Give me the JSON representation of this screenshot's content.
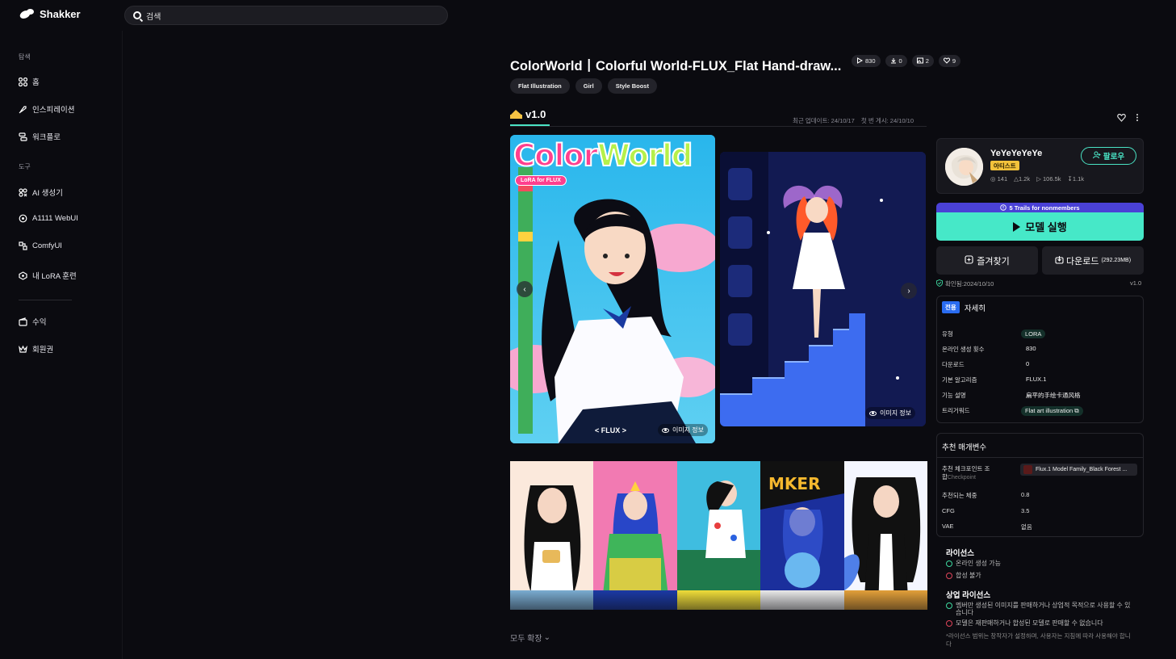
{
  "brand": {
    "name": "Shakker"
  },
  "search": {
    "text": "검색"
  },
  "sidebar": {
    "sections": [
      {
        "label": "탐색"
      },
      {
        "label": "도구"
      }
    ],
    "items": [
      {
        "label": "홈",
        "icon": "grid-icon"
      },
      {
        "label": "인스피레이션",
        "icon": "rocket-icon"
      },
      {
        "label": "워크플로",
        "icon": "workflow-icon"
      },
      {
        "label": "AI 생성기",
        "icon": "ai-generator-icon"
      },
      {
        "label": "A1111 WebUI",
        "icon": "webui-icon"
      },
      {
        "label": "ComfyUI",
        "icon": "comfyui-icon"
      },
      {
        "label": "내 LoRA 훈련",
        "icon": "lora-train-icon"
      },
      {
        "label": "수익",
        "icon": "wallet-icon"
      },
      {
        "label": "회원권",
        "icon": "crown-icon"
      }
    ]
  },
  "model": {
    "title": "ColorWorld丨Colorful World-FLUX_Flat Hand-draw...",
    "stats": {
      "runs": "830",
      "downloads": "0",
      "images": "2",
      "likes": "9"
    },
    "tags": [
      "Flat Illustration",
      "Girl",
      "Style Boost"
    ],
    "version": "v1.0",
    "updated": "최근 업데이트: 24/10/17",
    "published": "첫 번 게시: 24/10/10",
    "image_info_label": "이미지 정보",
    "main_image_title_part1": "Color",
    "main_image_title_part2": "World",
    "main_image_badge": "LoRA for FLUX",
    "main_image_footer": "< FLUX >",
    "expand_all": "모두 확장"
  },
  "author": {
    "name": "YeYeYeYeYe",
    "badge": "아티스트",
    "followers": "141",
    "likes": "1.2k",
    "runs": "106.5k",
    "downloads": "1.1k",
    "follow_label": "팔로우"
  },
  "actions": {
    "trial": "5 Trails for nonmembers",
    "run": "모델 실행",
    "favorite": "즐겨찾기",
    "download": "다운로드",
    "download_size": "(292.23MB)",
    "verified": "확인됨:2024/10/10",
    "verified_version": "v1.0"
  },
  "details": {
    "exclusive": "전용",
    "title": "자세히",
    "rows": [
      {
        "k": "유형",
        "v": "LORA"
      },
      {
        "k": "온라인 생성 횟수",
        "v": "830"
      },
      {
        "k": "다운로드",
        "v": "0"
      },
      {
        "k": "기본 알고리즘",
        "v": "FLUX.1"
      },
      {
        "k": "기능 설명",
        "v": "扁平的手绘卡通风格"
      },
      {
        "k": "트리거워드",
        "v": "Flat art illustration"
      }
    ]
  },
  "params": {
    "title": "추천 매개변수",
    "checkpoint_label_1": "추천 체크포인트 조",
    "checkpoint_label_2": "합",
    "checkpoint_sub": "Checkpoint",
    "checkpoint_value": "Flux.1 Model Family_Black Forest ...",
    "rows": [
      {
        "k": "추천되는 체중",
        "v": "0.8"
      },
      {
        "k": "CFG",
        "v": "3.5"
      },
      {
        "k": "VAE",
        "v": "없음"
      }
    ]
  },
  "license": {
    "title": "라이선스",
    "items": [
      {
        "text": "온라인 생성 가능",
        "ok": true
      },
      {
        "text": "합성 불가",
        "ok": false
      }
    ],
    "commercial_title": "상업 라이선스",
    "commercial_items": [
      {
        "text": "멤버만 생성된 이미지를 판매하거나 상업적 목적으로 사용할 수 있습니다",
        "ok": true
      },
      {
        "text": "모델은 재판매하거나 합성된 모델로 판매할 수 없습니다",
        "ok": false
      }
    ],
    "note": "*라이선스 범위는 창작자가 설정하며, 사용자는 지침에 따라 사용해야 합니다"
  },
  "colors": {
    "accent": "#46e8c8",
    "artist": "#f3c23b",
    "trial": "#4a41d6"
  }
}
